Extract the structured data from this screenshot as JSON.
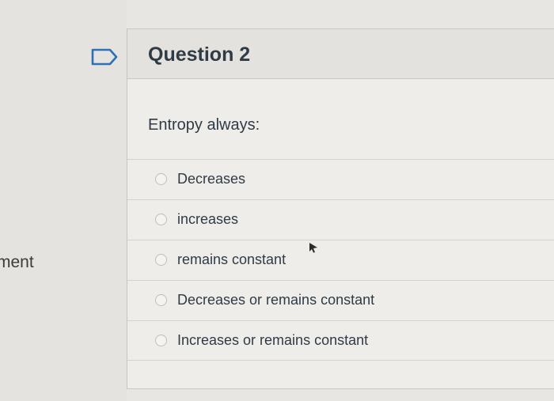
{
  "side_panel": {
    "partial_text": "ment"
  },
  "question": {
    "title": "Question 2",
    "prompt": "Entropy always:",
    "flag_icon": "flag-outline-icon",
    "answers": [
      {
        "label": "Decreases",
        "selected": false
      },
      {
        "label": "increases",
        "selected": false
      },
      {
        "label": "remains constant",
        "selected": false
      },
      {
        "label": "Decreases or remains constant",
        "selected": false
      },
      {
        "label": "Increases or remains constant",
        "selected": false
      }
    ]
  },
  "colors": {
    "text": "#2f3b45",
    "card_bg": "#eeedea",
    "header_bg": "#e3e2df",
    "divider": "#d3d2cf"
  }
}
